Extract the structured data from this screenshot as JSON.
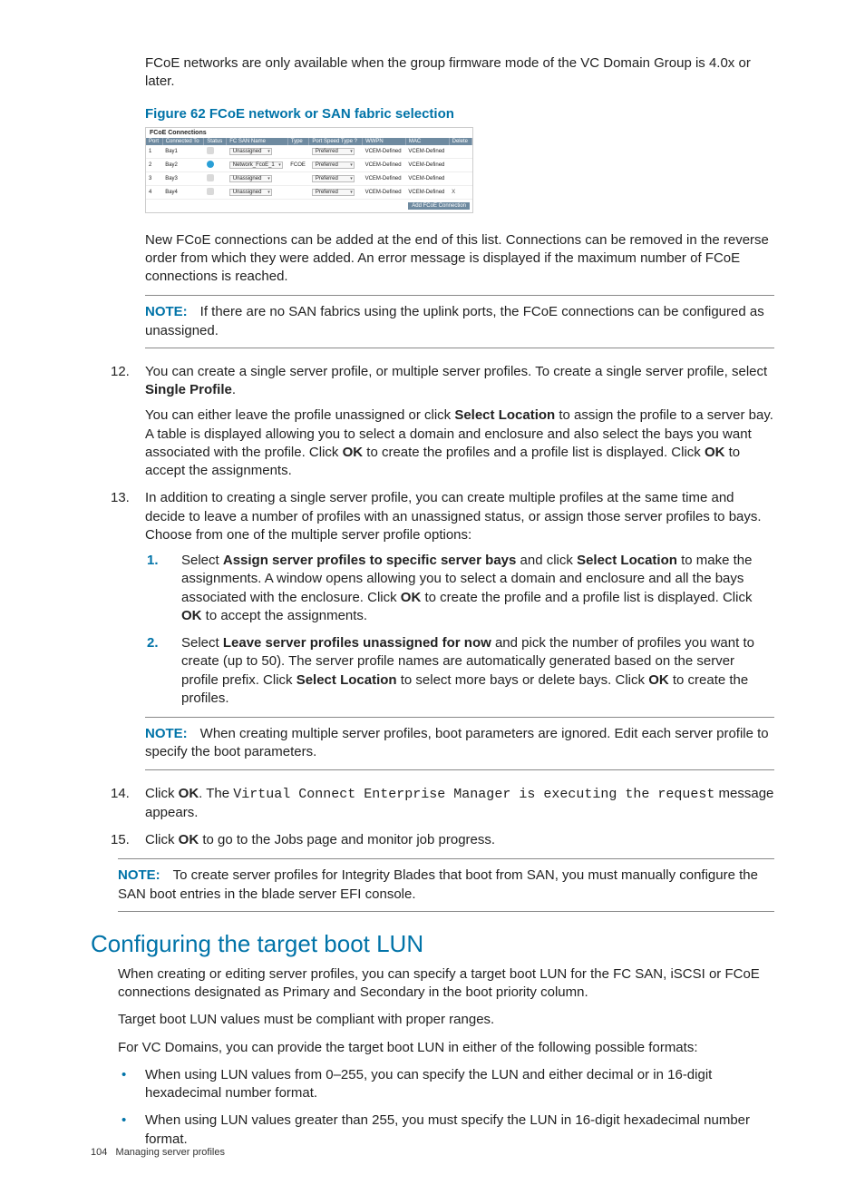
{
  "intro_para": "FCoE networks are only available when the group firmware mode of the VC Domain Group is 4.0x or later.",
  "figure_title": "Figure 62 FCoE network or SAN fabric selection",
  "fcoe_table": {
    "caption": "FCoE Connections",
    "headers": [
      "Port",
      "Connected To",
      "Status",
      "FC SAN Name",
      "Type",
      "Port Speed Type  ?",
      "WWPN",
      "MAC",
      "Delete"
    ],
    "rows": [
      {
        "port": "1",
        "conn": "Bay1",
        "status": "gray",
        "san": "Unassigned",
        "type": "",
        "speed": "Preferred",
        "wwpn": "VCEM-Defined",
        "mac": "VCEM-Defined",
        "del": ""
      },
      {
        "port": "2",
        "conn": "Bay2",
        "status": "info",
        "san": "Network_FcoE_1",
        "type": "FCOE",
        "speed": "Preferred",
        "wwpn": "VCEM-Defined",
        "mac": "VCEM-Defined",
        "del": ""
      },
      {
        "port": "3",
        "conn": "Bay3",
        "status": "gray",
        "san": "Unassigned",
        "type": "",
        "speed": "Preferred",
        "wwpn": "VCEM-Defined",
        "mac": "VCEM-Defined",
        "del": ""
      },
      {
        "port": "4",
        "conn": "Bay4",
        "status": "gray",
        "san": "Unassigned",
        "type": "",
        "speed": "Preferred",
        "wwpn": "VCEM-Defined",
        "mac": "VCEM-Defined",
        "del": "X"
      }
    ],
    "add_button": "Add FCoE Connection"
  },
  "para_after_figure": "New FCoE connections can be added at the end of this list. Connections can be removed in the reverse order from which they were added. An error message is displayed if the maximum number of FCoE connections is reached.",
  "note1_label": "NOTE:",
  "note1_text": "If there are no SAN fabrics using the uplink ports, the FCoE connections can be configured as unassigned.",
  "li12_num": "12.",
  "li12_a": "You can create a single server profile, or multiple server profiles. To create a single server profile, select ",
  "li12_b": "Single Profile",
  "li12_c": ".",
  "li12_p2_a": "You can either leave the profile unassigned or click ",
  "li12_p2_b": "Select Location",
  "li12_p2_c": " to assign the profile to a server bay. A table is displayed allowing you to select a domain and enclosure and also select the bays you want associated with the profile. Click ",
  "li12_p2_d": "OK",
  "li12_p2_e": " to create the profiles and a profile list is displayed. Click ",
  "li12_p2_f": "OK",
  "li12_p2_g": " to accept the assignments.",
  "li13_num": "13.",
  "li13_a": "In addition to creating a single server profile, you can create multiple profiles at the same time and decide to leave a number of profiles with an unassigned status, or assign those server profiles to bays. Choose from one of the multiple server profile options:",
  "li13_s1_num": "1.",
  "li13_s1_a": "Select ",
  "li13_s1_b": "Assign server profiles to specific server bays",
  "li13_s1_c": " and click ",
  "li13_s1_d": "Select Location",
  "li13_s1_e": " to make the assignments. A window opens allowing you to select a domain and enclosure and all the bays associated with the enclosure. Click ",
  "li13_s1_f": "OK",
  "li13_s1_g": " to create the profile and a profile list is displayed. Click ",
  "li13_s1_h": "OK",
  "li13_s1_i": " to accept the assignments.",
  "li13_s2_num": "2.",
  "li13_s2_a": "Select ",
  "li13_s2_b": "Leave server profiles unassigned for now",
  "li13_s2_c": " and pick the number of profiles you want to create (up to 50). The server profile names are automatically generated based on the server profile prefix. Click ",
  "li13_s2_d": "Select Location",
  "li13_s2_e": " to select more bays or delete bays. Click ",
  "li13_s2_f": "OK",
  "li13_s2_g": " to create the profiles.",
  "note2_label": "NOTE:",
  "note2_text": "When creating multiple server profiles, boot parameters are ignored. Edit each server profile to specify the boot parameters.",
  "li14_num": "14.",
  "li14_a": "Click ",
  "li14_b": "OK",
  "li14_c": ". The ",
  "li14_mono": "Virtual Connect Enterprise Manager is executing the request",
  "li14_d": " message appears.",
  "li15_num": "15.",
  "li15_a": "Click ",
  "li15_b": "OK",
  "li15_c": " to go to the Jobs page and monitor job progress.",
  "note3_label": "NOTE:",
  "note3_text": "To create server profiles for Integrity Blades that boot from SAN, you must manually configure the SAN boot entries in the blade server EFI console.",
  "section_heading": "Configuring the target boot LUN",
  "sec_p1": "When creating or editing server profiles, you can specify a target boot LUN for the FC SAN, iSCSI or FCoE connections designated as Primary and Secondary in the boot priority column.",
  "sec_p2": "Target boot LUN values must be compliant with proper ranges.",
  "sec_p3": "For VC Domains, you can provide the target boot LUN in either of the following possible formats:",
  "bullet1": "When using LUN values from 0–255, you can specify the LUN and either decimal or in 16-digit hexadecimal number format.",
  "bullet2": "When using LUN values greater than 255, you must specify the LUN in 16-digit hexadecimal number format.",
  "footer_page": "104",
  "footer_text": "Managing server profiles"
}
